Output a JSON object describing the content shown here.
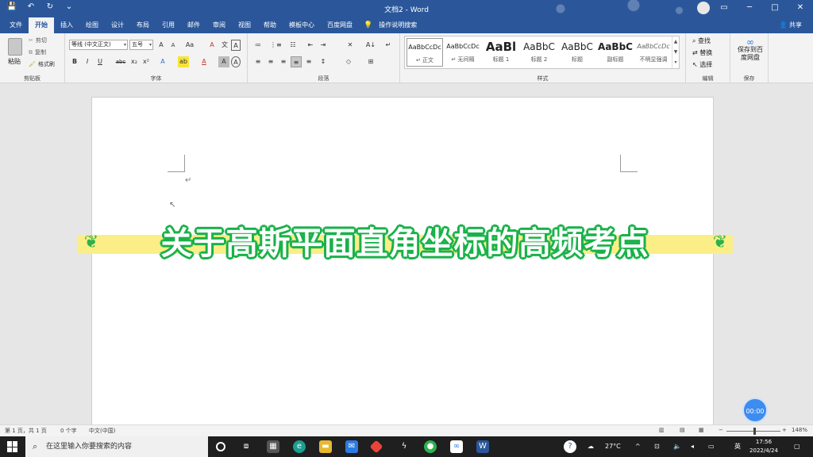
{
  "titlebar": {
    "title": "文档2 - Word",
    "qat": [
      "save-icon",
      "undo-icon",
      "redo-icon",
      "customize-icon"
    ],
    "window_buttons": [
      "ribbon-display-icon",
      "minimize-icon",
      "restore-icon",
      "close-icon"
    ]
  },
  "tabs": [
    "文件",
    "开始",
    "插入",
    "绘图",
    "设计",
    "布局",
    "引用",
    "邮件",
    "审阅",
    "视图",
    "帮助",
    "模板中心",
    "百度网盘"
  ],
  "active_tab": "开始",
  "tell_me": "操作说明搜索",
  "share": "共享",
  "clipboard": {
    "paste": "粘贴",
    "cut": "剪切",
    "copy": "复制",
    "format_painter": "格式刷",
    "label": "剪贴板"
  },
  "font": {
    "name": "等线 (中文正文)",
    "size": "五号",
    "label": "字体",
    "row2": [
      "B",
      "I",
      "U",
      "abc",
      "x₂",
      "x²",
      "A",
      "ab",
      "A",
      "A",
      "A"
    ],
    "row1_tools": [
      "A",
      "A",
      "Aa",
      "A",
      "文",
      "A"
    ]
  },
  "paragraph": {
    "label": "段落",
    "row1": [
      "≔",
      "⋮≡",
      "☷",
      "⇤",
      "⇥",
      "✕",
      "A↓",
      "↵"
    ],
    "row2": [
      "≡",
      "≡",
      "≡",
      "≡",
      "≡",
      "↕",
      "◇",
      "⊞"
    ]
  },
  "styles": {
    "label": "样式",
    "items": [
      {
        "sample": "AaBbCcDc",
        "name": "↵ 正文"
      },
      {
        "sample": "AaBbCcDc",
        "name": "↵ 无间隔"
      },
      {
        "sample": "AaBl",
        "name": "标题 1"
      },
      {
        "sample": "AaBbC",
        "name": "标题 2"
      },
      {
        "sample": "AaBbC",
        "name": "标题"
      },
      {
        "sample": "AaBbC",
        "name": "副标题"
      },
      {
        "sample": "AaBbCcDc",
        "name": "不明显强调"
      }
    ]
  },
  "editing": {
    "find": "查找",
    "replace": "替换",
    "select": "选择",
    "label": "编辑"
  },
  "save": {
    "button": "保存到百度网盘",
    "label": "保存"
  },
  "document": {
    "banner_text": "关于高斯平面直角坐标的高频考点",
    "highlight_color": "#fbee86",
    "text_outline_color": "#19b24a"
  },
  "timer": "00:00",
  "status": {
    "page": "第 1 页，共 1 页",
    "words": "0 个字",
    "language": "中文(中国)",
    "zoom": "148%",
    "zoom_level": 1.48
  },
  "taskbar": {
    "search_placeholder": "在这里输入你要搜索的内容",
    "apps": [
      "cortana-icon",
      "task-view-icon",
      "store-icon",
      "edge-icon",
      "file-explorer-icon",
      "mail-icon",
      "app-icon",
      "app-icon",
      "wechat-icon",
      "baidu-netdisk-icon",
      "word-icon"
    ],
    "weather": "27°C",
    "ime": "英",
    "time": "17:56",
    "date": "2022/4/24"
  },
  "colors": {
    "word_blue": "#2b579a",
    "ribbon_bg": "#f3f3f3",
    "banner_green": "#19b24a"
  }
}
